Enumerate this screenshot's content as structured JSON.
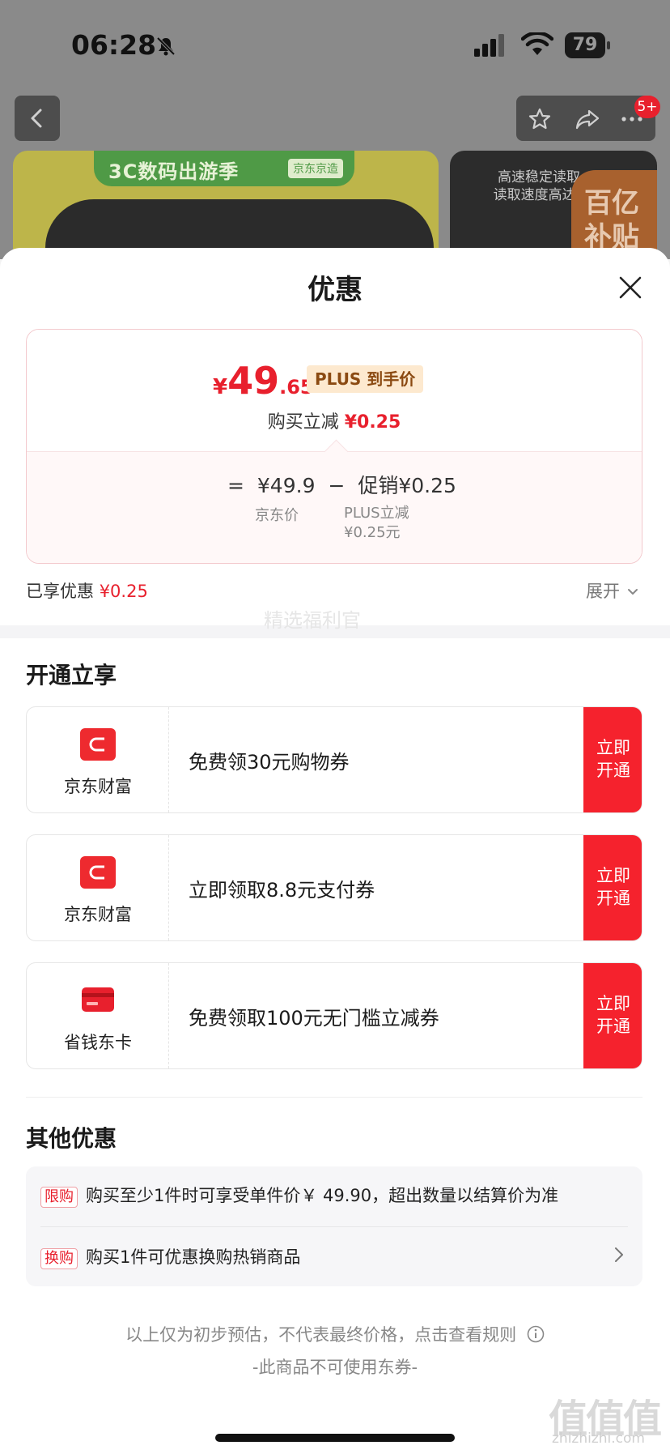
{
  "status_bar": {
    "time": "06:28",
    "battery": "79"
  },
  "nav": {
    "badge": "5+"
  },
  "background_banners": {
    "left_title": "3C数码出游季",
    "left_brand": "京东京造",
    "right_line1": "高速稳定读取",
    "right_line2": "读取速度高达1",
    "right_promo": "百亿补贴"
  },
  "sheet": {
    "title": "优惠",
    "price": {
      "symbol": "¥",
      "integer": "49",
      "decimal": ".65",
      "tag": "PLUS 到手价"
    },
    "reduce": {
      "label": "购买立减",
      "amount": "¥0.25"
    },
    "formula": {
      "eq": "=",
      "jd_price": "¥49.9",
      "minus": "−",
      "promo": "促销¥0.25",
      "jd_price_label": "京东价",
      "promo_label_1": "PLUS立减",
      "promo_label_2": "¥0.25元"
    },
    "enjoyed": {
      "label": "已享优惠",
      "amount": "¥0.25"
    },
    "expand": "展开",
    "open_section": {
      "title": "开通立享",
      "watermark": "精选福利官",
      "offers": [
        {
          "brand": "京东财富",
          "text": "免费领30元购物券",
          "button_line1": "立即",
          "button_line2": "开通",
          "icon": "wallet-icon"
        },
        {
          "brand": "京东财富",
          "text": "立即领取8.8元支付券",
          "button_line1": "立即",
          "button_line2": "开通",
          "icon": "wallet-icon"
        },
        {
          "brand": "省钱东卡",
          "text": "免费领取100元无门槛立减券",
          "button_line1": "立即",
          "button_line2": "开通",
          "icon": "card-icon"
        }
      ]
    },
    "other_section": {
      "title": "其他优惠",
      "rows": [
        {
          "tag": "限购",
          "text": "购买至少1件时可享受单件价￥ 49.90，超出数量以结算价为准"
        },
        {
          "tag": "换购",
          "text": "购买1件可优惠换购热销商品"
        }
      ]
    },
    "footer": {
      "note": "以上仅为初步预估，不代表最终价格，点击查看规则",
      "no_coupon": "-此商品不可使用东券-"
    },
    "corner_watermark": {
      "main": "值值值",
      "sub": "zhizhizhi.com"
    }
  },
  "colors": {
    "accent_red": "#f5222d",
    "price_red": "#e8202d",
    "plus_tag_bg": "#fde9cf"
  }
}
